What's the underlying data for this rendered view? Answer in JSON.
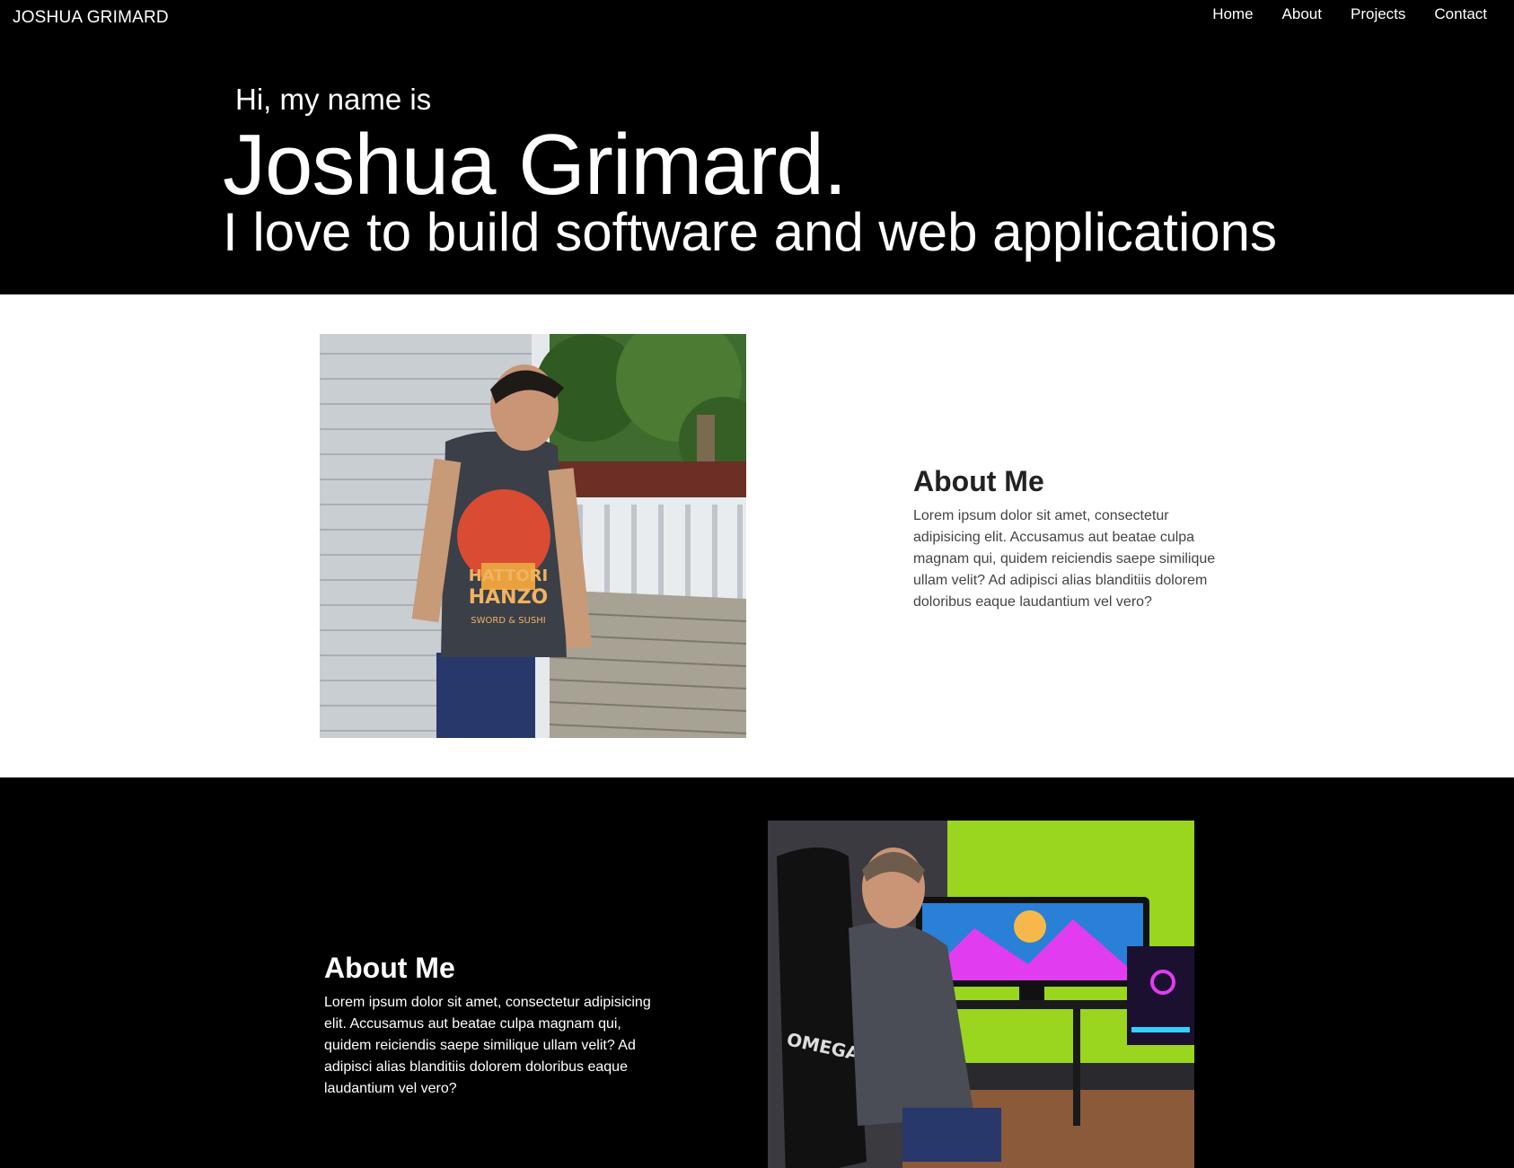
{
  "navbar": {
    "brand": "JOSHUA GRIMARD",
    "links": [
      {
        "label": "Home"
      },
      {
        "label": "About"
      },
      {
        "label": "Projects"
      },
      {
        "label": "Contact"
      }
    ]
  },
  "hero": {
    "intro": "Hi, my name is",
    "name": "Joshua Grimard.",
    "tagline": "I love to build software and web applications"
  },
  "about_sections": [
    {
      "title": "About Me",
      "body": "Lorem ipsum dolor sit amet, consectetur adipisicing elit. Accusamus aut beatae culpa magnam qui, quidem reiciendis saepe similique ullam velit? Ad adipisci alias blanditiis dolorem doloribus eaque laudantium vel vero?",
      "image": "photo-man-on-deck"
    },
    {
      "title": "About Me",
      "body": "Lorem ipsum dolor sit amet, consectetur adipisicing elit. Accusamus aut beatae culpa magnam qui, quidem reiciendis saepe similique ullam velit? Ad adipisci alias blanditiis dolorem doloribus eaque laudantium vel vero?",
      "image": "photo-man-at-gaming-desk",
      "image_text": {
        "shirt_line1": "HATTORI",
        "shirt_line2": "HANZO",
        "shirt_line3": "SWORD & SUSHI",
        "chair_logo": "OMEGA"
      }
    }
  ],
  "colors": {
    "dark_bg": "#000000",
    "light_bg": "#ffffff",
    "heading_dark": "#222222",
    "body_dark": "#444444",
    "accent_green": "#9ad51f",
    "accent_magenta": "#e23cf0"
  }
}
